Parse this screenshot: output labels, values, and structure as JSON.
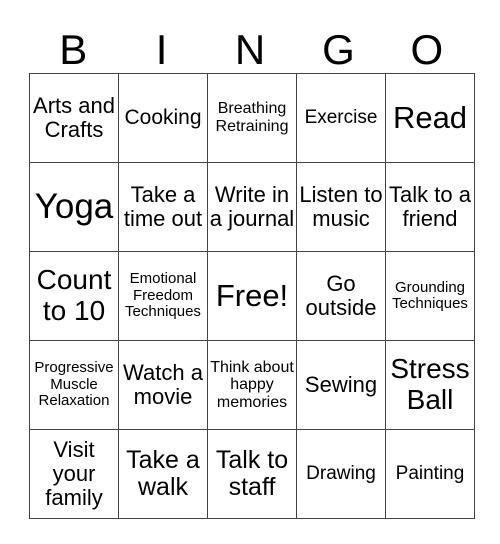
{
  "header": {
    "letters": [
      "B",
      "I",
      "N",
      "G",
      "O"
    ]
  },
  "board": {
    "rows": [
      [
        "Arts and Crafts",
        "Cooking",
        "Breathing Retraining",
        "Exercise",
        "Read"
      ],
      [
        "Yoga",
        "Take a time out",
        "Write in a journal",
        "Listen to music",
        "Talk to a friend"
      ],
      [
        "Count to 10",
        "Emotional Freedom Techniques",
        "Free!",
        "Go outside",
        "Grounding Techniques"
      ],
      [
        "Progressive Muscle Relaxation",
        "Watch a movie",
        "Think about happy memories",
        "Sewing",
        "Stress Ball"
      ],
      [
        "Visit your family",
        "Take a walk",
        "Talk to staff",
        "Drawing",
        "Painting"
      ]
    ]
  }
}
